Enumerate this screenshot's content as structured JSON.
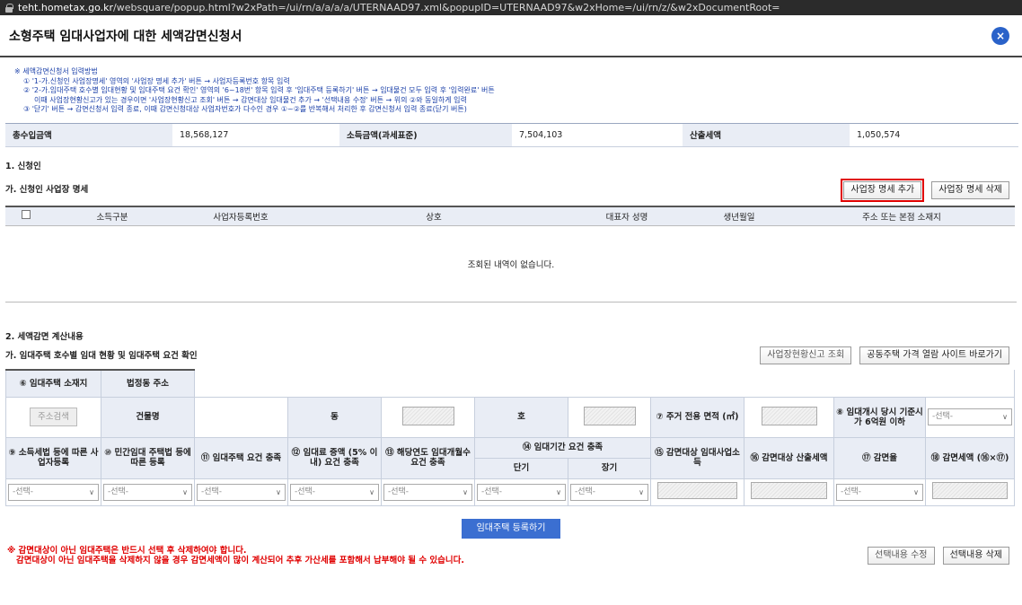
{
  "browser": {
    "domain": "teht.hometax.go.kr",
    "path": "/websquare/popup.html?w2xPath=/ui/rn/a/a/a/a/UTERNAAD97.xml&popupID=UTERNAAD97&w2xHome=/ui/rn/z/&w2xDocumentRoot="
  },
  "window": {
    "title": "소형주택 임대사업자에 대한 세액감면신청서",
    "close_label": "×"
  },
  "guide": {
    "title": "※ 세액감면신청서 입력방법",
    "lines": [
      "① '1-가.신청인 사업장명세' 영역의 '사업장 명세 추가' 버튼 → 사업자등록번호 항목 입력",
      "② '2-가.임대주택 호수별 임대현황 및 임대주택 요건 확인' 영역의 '6~18번' 항목 입력 후 '임대주택 등록하기' 버튼 → 임대물건 모두 입력 후 '입력완료' 버튼",
      "이때 사업장현황신고가 있는 경우이면 '사업장현황신고 조회' 버튼 → 감면대상 임대물건 추가 → '선택내용 수정' 버튼 → 위의 ②와 동일하게 입력",
      "③ '닫기' 버튼 → 감면신청서 입력 종료, 이때 감면신청대상 사업자번호가 다수인 경우 ①~②를 반복해서 처리한 후 감면신청서 입력 종료(닫기 버튼)"
    ]
  },
  "summary": {
    "total_income_label": "총수입금액",
    "total_income": "18,568,127",
    "income_label": "소득금액(과세표준)",
    "income": "7,504,103",
    "tax_label": "산출세액",
    "tax": "1,050,574"
  },
  "section1": {
    "title": "1. 신청인",
    "sub": "가. 신청인 사업장 명세",
    "add_btn": "사업장 명세 추가",
    "del_btn": "사업장 명세 삭제",
    "columns": [
      "소득구분",
      "사업자등록번호",
      "상호",
      "대표자 성명",
      "생년월일",
      "주소 또는 본점 소재지"
    ],
    "empty": "조회된 내역이 없습니다."
  },
  "section2": {
    "title": "2. 세액감면 계산내용",
    "sub": "가. 임대주택 호수별 임대 현황 및 임대주택 요건 확인",
    "btn_lookup": "사업장현황신고 조회",
    "btn_price": "공동주택 가격 열람 사이트 바로가기",
    "h_location": "⑥ 임대주택 소재지",
    "h_legal_addr": "법정동 주소",
    "addr_search": "주소검색",
    "h_building": "건물명",
    "h_dong": "동",
    "h_ho": "호",
    "h_area": "⑦ 주거 전용 면적 (㎡)",
    "h_price": "⑧ 임대개시 당시 기준시가 6억원 이하",
    "h_9": "⑨ 소득세법 등에 따른 사업자등록",
    "h_10": "⑩ 민간임대 주택법 등에 따른 등록",
    "h_11": "⑪ 임대주택 요건 충족",
    "h_12": "⑫ 임대료 증액 (5% 이내) 요건 충족",
    "h_13": "⑬ 해당연도 임대개월수 요건 충족",
    "h_14": "⑭ 임대기간 요건 충족",
    "h_short": "단기",
    "h_long": "장기",
    "h_15": "⑮ 감면대상 임대사업소득",
    "h_16": "⑯ 감면대상 산출세액",
    "h_17": "⑰ 감면율",
    "h_18": "⑱ 감면세액 (⑯×⑰)",
    "select_placeholder": "-선택-",
    "register_btn": "임대주택 등록하기",
    "warn1": "※ 감면대상이 아닌 임대주택은 반드시 선택 후 삭제하여야 합니다.",
    "warn2": "감면대상이 아닌 임대주택을 삭제하지 않을 경우 감면세액이 많이 계산되어 추후 가산세를 포함해서 납부해야 될 수 있습니다.",
    "edit_btn": "선택내용 수정",
    "del_btn": "선택내용 삭제"
  }
}
